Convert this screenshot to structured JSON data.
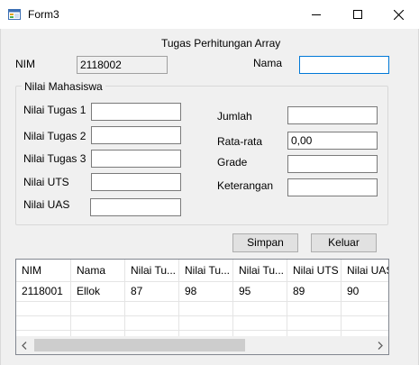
{
  "window": {
    "title": "Form3",
    "icon": "form-icon",
    "controls": [
      "minimize-icon",
      "maximize-icon",
      "close-icon"
    ]
  },
  "header": {
    "title": "Tugas Perhitungan Array"
  },
  "form": {
    "nim_label": "NIM",
    "nim_value": "2118002",
    "nama_label": "Nama",
    "nama_value": ""
  },
  "group": {
    "title": "Nilai Mahasiswa",
    "tugas1_label": "Nilai Tugas 1",
    "tugas1_value": "",
    "tugas2_label": "Nilai Tugas 2",
    "tugas2_value": "",
    "tugas3_label": "Nilai Tugas 3",
    "tugas3_value": "",
    "uts_label": "Nilai UTS",
    "uts_value": "",
    "uas_label": "Nilai UAS",
    "uas_value": "",
    "jumlah_label": "Jumlah",
    "jumlah_value": "",
    "ratarata_label": "Rata-rata",
    "ratarata_value": "0,00",
    "grade_label": "Grade",
    "grade_value": "",
    "keterangan_label": "Keterangan",
    "keterangan_value": ""
  },
  "buttons": {
    "simpan": "Simpan",
    "keluar": "Keluar"
  },
  "grid": {
    "columns": [
      "NIM",
      "Nama",
      "Nilai Tu...",
      "Nilai Tu...",
      "Nilai Tu...",
      "Nilai UTS",
      "Nilai UAS"
    ],
    "rows": [
      [
        "2118001",
        "Ellok",
        "87",
        "98",
        "95",
        "89",
        "90"
      ]
    ]
  }
}
